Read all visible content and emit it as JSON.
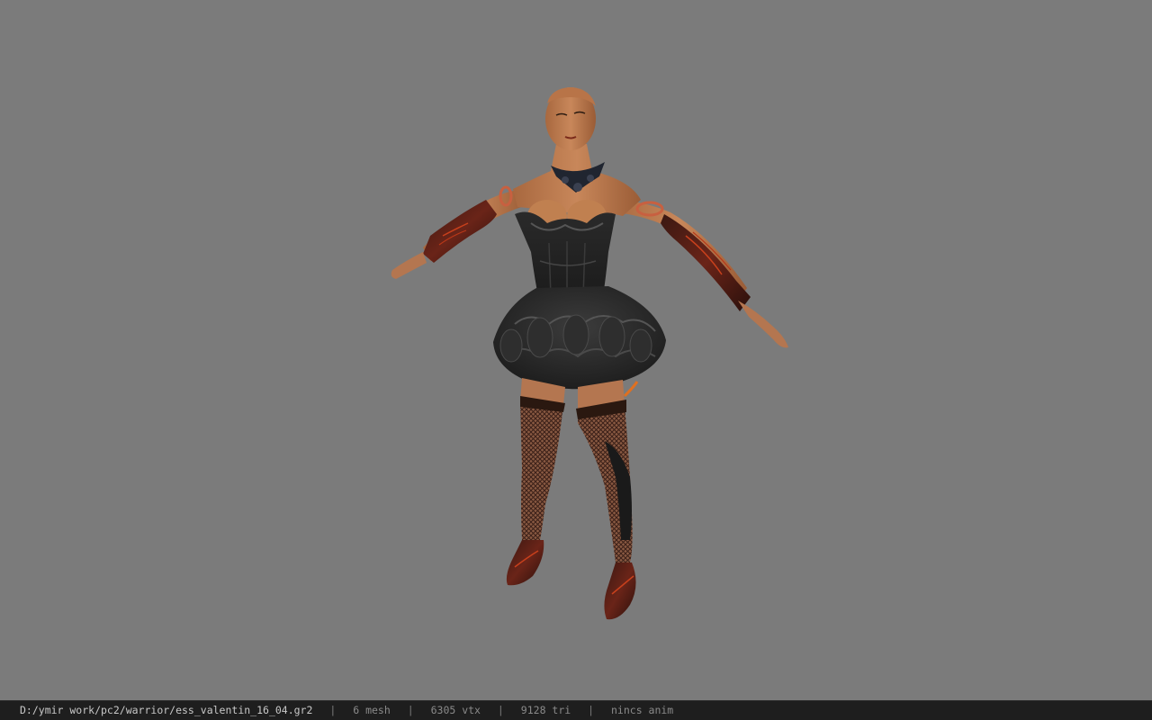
{
  "viewport": {
    "background_color": "#7b7b7b",
    "model_description_icon": "character-model"
  },
  "statusbar": {
    "file_path": "D:/ymir work/pc2/warrior/ess_valentin_16_04.gr2",
    "separator": "|",
    "mesh_count": "6 mesh",
    "vertex_count": "6305 vtx",
    "triangle_count": "9128 tri",
    "anim_status": "nincs anim",
    "colors": {
      "background": "#1e1e1e",
      "path_text": "#c8c8c8",
      "info_text": "#8a8a8a"
    }
  }
}
